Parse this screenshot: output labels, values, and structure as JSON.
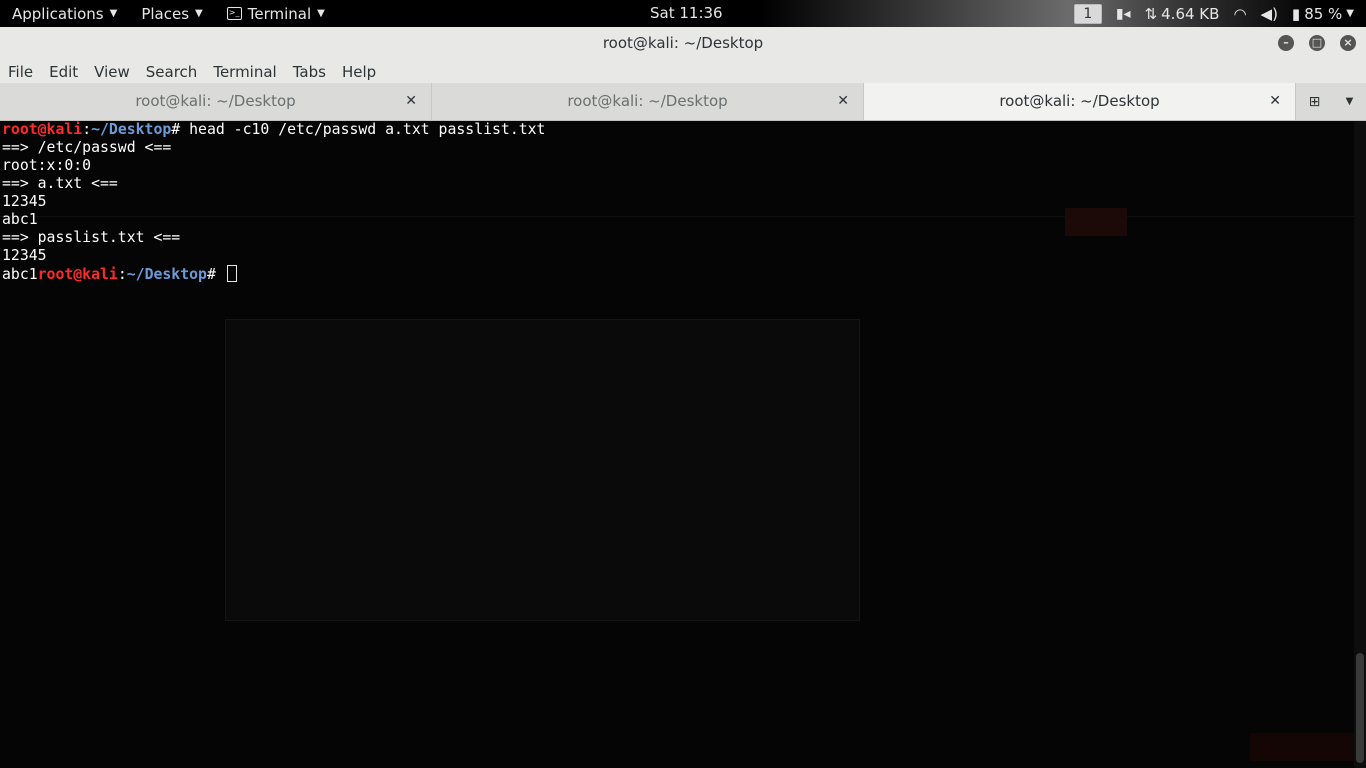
{
  "topbar": {
    "applications": "Applications",
    "places": "Places",
    "terminal": "Terminal",
    "clock": "Sat 11:36",
    "workspace": "1",
    "network_speed": "4.64 KB",
    "battery": "85 %"
  },
  "window": {
    "title": "root@kali: ~/Desktop"
  },
  "menubar": {
    "items": [
      "File",
      "Edit",
      "View",
      "Search",
      "Terminal",
      "Tabs",
      "Help"
    ]
  },
  "tabs": [
    {
      "label": "root@kali: ~/Desktop",
      "active": false
    },
    {
      "label": "root@kali: ~/Desktop",
      "active": false
    },
    {
      "label": "root@kali: ~/Desktop",
      "active": true
    }
  ],
  "terminal": {
    "prompt_user": "root@kali",
    "prompt_sep": ":",
    "prompt_path": "~/Desktop",
    "prompt_symbol": "# ",
    "command": "head -c10 /etc/passwd a.txt passlist.txt",
    "output": [
      "==> /etc/passwd <==",
      "root:x:0:0",
      "==> a.txt <==",
      "12345",
      "abc1",
      "==> passlist.txt <==",
      "12345"
    ],
    "last_prefix": "abc1"
  },
  "colors": {
    "prompt_user": "#ff2b2b",
    "prompt_path": "#6e9bd8",
    "terminal_bg": "#050505"
  }
}
